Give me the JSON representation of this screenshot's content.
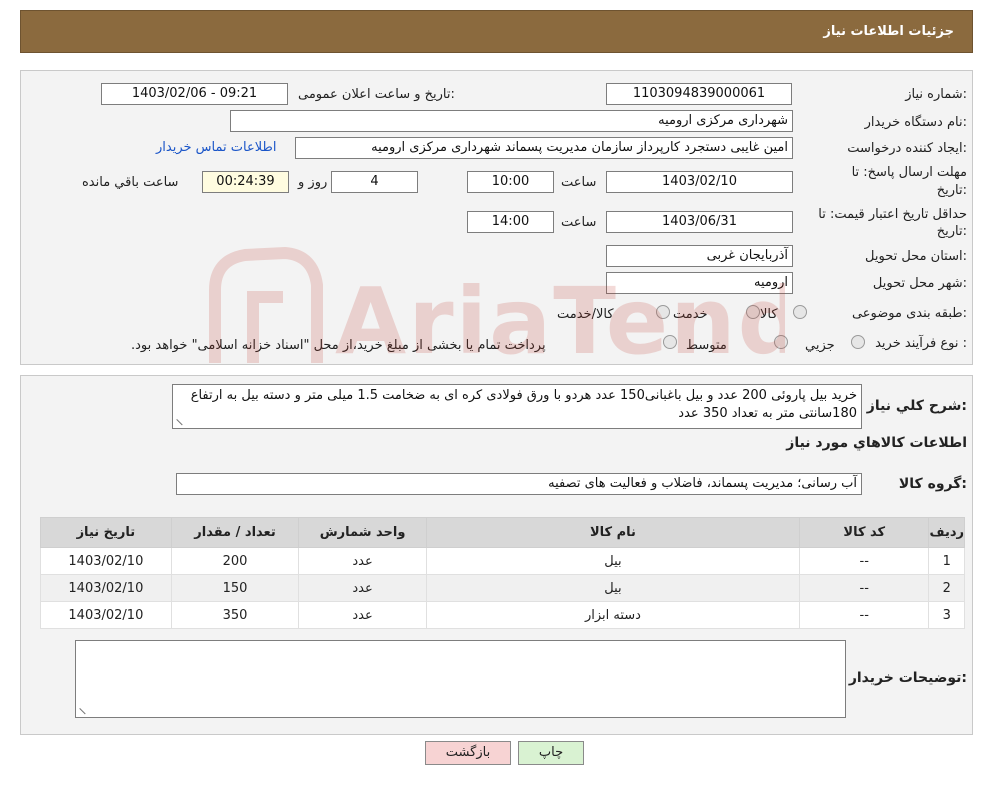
{
  "header": {
    "title": "جزئیات اطلاعات نیاز"
  },
  "fields": {
    "need_number_label": "شماره نیاز:",
    "need_number": "1103094839000061",
    "announce_label": "تاریخ و ساعت اعلان عمومی:",
    "announce_value": "1403/02/06 - 09:21",
    "buyer_org_label": "نام دستگاه خریدار:",
    "buyer_org": "شهرداری مرکزی ارومیه",
    "creator_label": "ایجاد کننده درخواست:",
    "creator": "امین غایبی دستجرد کارپرداز سازمان مدیریت پسماند شهرداری مرکزی ارومیه",
    "contact_link": "اطلاعات تماس خریدار",
    "deadline_label_1": "مهلت ارسال پاسخ: تا",
    "deadline_label_2": "تاریخ:",
    "deadline_date": "1403/02/10",
    "time_label": "ساعت",
    "deadline_time": "10:00",
    "days_value": "4",
    "days_label": "روز و",
    "remaining_time": "00:24:39",
    "remaining_label": "ساعت باقي مانده",
    "validity_label_1": "حداقل تاریخ اعتبار قیمت: تا",
    "validity_label_2": "تاریخ:",
    "validity_date": "1403/06/31",
    "validity_time": "14:00",
    "province_label": "استان محل تحویل:",
    "province": "آذربایجان غربی",
    "city_label": "شهر محل تحویل:",
    "city": "ارومیه",
    "category_label": "طبقه بندی موضوعی:",
    "category_options": [
      "کالا",
      "خدمت",
      "کالا/خدمت"
    ],
    "process_label": "نوع فرآیند خرید :",
    "process_options": [
      "جزيي",
      "متوسط"
    ],
    "process_note": "پرداخت تمام یا بخشی از مبلغ خرید،از محل \"اسناد خزانه اسلامی\" خواهد بود."
  },
  "description": {
    "label": "شرح کلي نياز:",
    "text": "خرید بیل پاروئی 200 عدد و بیل باغبانی150 عدد هردو با ورق فولادی کره ای به ضخامت 1.5 میلی متر و دسته بیل به ارتفاع 180سانتی متر به تعداد 350 عدد"
  },
  "goods": {
    "section_title": "اطلاعات کالاهاي مورد نياز",
    "group_label": "گروه کالا:",
    "group_value": "آب رسانی؛ مدیریت پسماند، فاضلاب و فعالیت های تصفیه",
    "columns": [
      "رديف",
      "کد کالا",
      "نام کالا",
      "واحد شمارش",
      "تعداد / مقدار",
      "تاریخ نیاز"
    ],
    "rows": [
      [
        "1",
        "--",
        "بیل",
        "عدد",
        "200",
        "1403/02/10"
      ],
      [
        "2",
        "--",
        "بیل",
        "عدد",
        "150",
        "1403/02/10"
      ],
      [
        "3",
        "--",
        "دسته ابزار",
        "عدد",
        "350",
        "1403/02/10"
      ]
    ]
  },
  "notes": {
    "label": "توضیحات خریدار:",
    "value": ""
  },
  "buttons": {
    "back": "بازگشت",
    "print": "چاپ"
  },
  "watermark": {
    "text": "AriaTender.neT",
    "color": "#c0392b"
  }
}
